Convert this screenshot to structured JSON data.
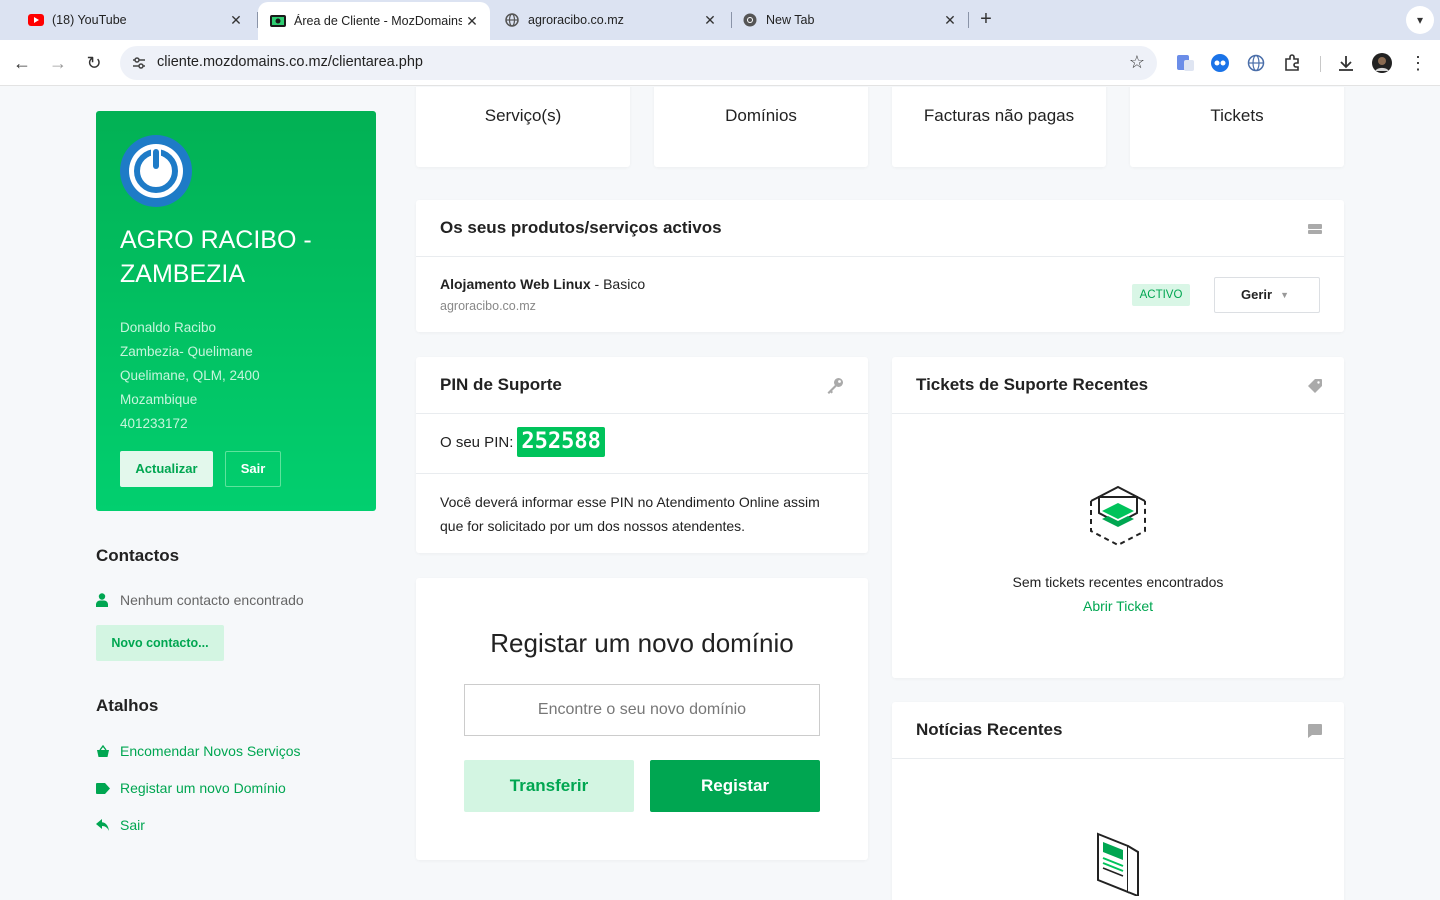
{
  "browser": {
    "tabs": [
      {
        "title": "(18) YouTube",
        "icon": "youtube-icon"
      },
      {
        "title": "Área de Cliente - MozDomains",
        "icon": "mozdomains-icon"
      },
      {
        "title": "agroracibo.co.mz",
        "icon": "globe-icon"
      },
      {
        "title": "New Tab",
        "icon": "chrome-icon"
      }
    ],
    "url": "cliente.mozdomains.co.mz/clientarea.php"
  },
  "colors": {
    "accent": "#00a651",
    "accent_light": "#d3f5e2",
    "profile_gradient_top": "#02b154",
    "profile_gradient_bottom": "#02cf6f"
  },
  "profile": {
    "name": "AGRO RACIBO - ZAMBEZIA",
    "address_lines": [
      "Donaldo Racibo",
      "Zambezia- Quelimane",
      "Quelimane, QLM, 2400",
      "Mozambique",
      "401233172"
    ],
    "update_label": "Actualizar",
    "logout_label": "Sair"
  },
  "contacts": {
    "heading": "Contactos",
    "empty_text": "Nenhum contacto encontrado",
    "new_contact_label": "Novo contacto..."
  },
  "shortcuts": {
    "heading": "Atalhos",
    "items": [
      {
        "label": "Encomendar Novos Serviços",
        "icon": "basket-icon"
      },
      {
        "label": "Registar um novo Domínio",
        "icon": "tag-icon"
      },
      {
        "label": "Sair",
        "icon": "reply-icon"
      }
    ]
  },
  "tiles": [
    "Serviço(s)",
    "Domínios",
    "Facturas não pagas",
    "Tickets"
  ],
  "active_services": {
    "heading": "Os seus produtos/serviços activos",
    "product": "Alojamento Web Linux",
    "plan": " - Basico",
    "domain": "agroracibo.co.mz",
    "status": "ACTIVO",
    "manage_label": "Gerir"
  },
  "support_pin": {
    "heading": "PIN de Suporte",
    "pin_label": "O seu PIN:",
    "pin": "252588",
    "info": "Você deverá informar esse PIN no Atendimento Online assim que for solicitado por um dos nossos atendentes."
  },
  "domain_register": {
    "title": "Registar um novo domínio",
    "placeholder": "Encontre o seu novo domínio",
    "transfer_label": "Transferir",
    "register_label": "Registar"
  },
  "tickets": {
    "heading": "Tickets de Suporte Recentes",
    "empty_text": "Sem tickets recentes encontrados",
    "open_label": "Abrir Ticket"
  },
  "news": {
    "heading": "Notícias Recentes"
  }
}
